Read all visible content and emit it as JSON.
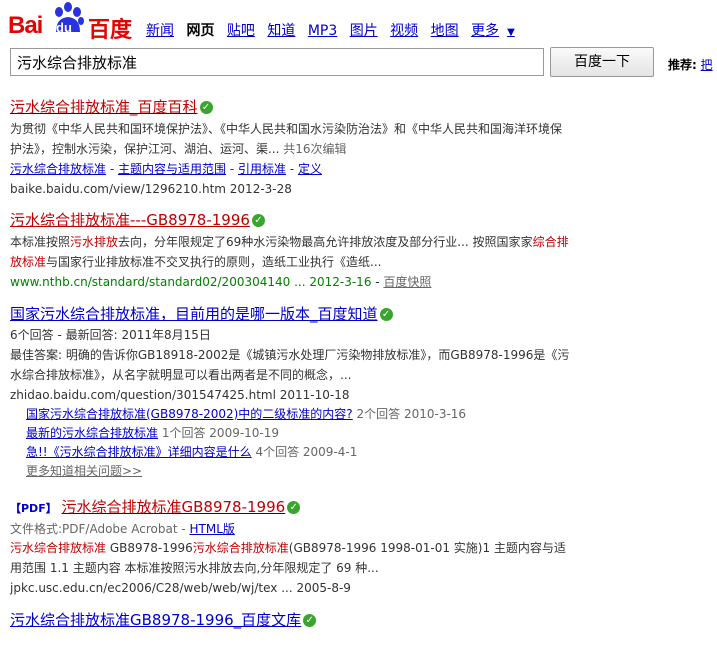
{
  "logo": {
    "bai": "Bai",
    "du": "du",
    "cn": "百度"
  },
  "nav": {
    "items": [
      "新闻",
      "网页",
      "贴吧",
      "知道",
      "MP3",
      "图片",
      "视频",
      "地图",
      "更多"
    ],
    "current": "网页",
    "more_arrow": "▼"
  },
  "search": {
    "value": "污水综合排放标准",
    "button": "百度一下"
  },
  "recommend": {
    "label": "推荐",
    "link": "把"
  },
  "results": [
    {
      "title": "污水综合排放标准_百度百科",
      "abstract": "为贯彻《中华人民共和国环境保护法》、《中华人民共和国水污染防治法》和《中华人民共和国海洋环境保护法》，控制水污染，保护江河、湖泊、运河、渠...",
      "edits": "共16次编辑",
      "sublinks": [
        "污水综合排放标准",
        "主题内容与适用范围",
        "引用标准",
        "定义"
      ],
      "url": "baike.baidu.com/view/1296210.htm 2012-3-28"
    },
    {
      "title": "污水综合排放标准---GB8978-1996",
      "abstract_pre": "本标准按照",
      "abstract_em": "污水排放",
      "abstract_post": "去向，分年限规定了69种水污染物最高允许排放浓度及部分行业... 按照国家",
      "abstract2_em": "综合排放标准",
      "abstract2_post": "与国家行业排放标准不交叉执行的原则，造纸工业执行《造纸...",
      "url": "www.nthb.cn/standard/standard02/200304140 ... 2012-3-16",
      "snapshot": "百度快照"
    },
    {
      "title": "国家污水综合排放标准，目前用的是哪一版本_百度知道",
      "meta": "6个回答 - 最新回答: 2011年8月15日",
      "abstract": "最佳答案: 明确的告诉你GB18918-2002是《城镇污水处理厂污染物排放标准》，而GB8978-1996是《污水综合排放标准》，从名字就明显可以看出两者是不同的概念，...",
      "url": "zhidao.baidu.com/question/301547425.html  2011-10-18",
      "subresults": [
        {
          "title": "国家污水综合排放标准(GB8978-2002)中的二级标准的内容?",
          "meta": "2个回答  2010-3-16"
        },
        {
          "title": "最新的污水综合排放标准",
          "meta": "1个回答  2009-10-19"
        },
        {
          "title": "急!!《污水综合排放标准》详细内容是什么",
          "meta": "4个回答  2009-4-1"
        }
      ],
      "more": "更多知道相关问题>>"
    },
    {
      "tag": "PDF",
      "title": "污水综合排放标准GB8978-1996",
      "format_label": "文件格式:PDF/Adobe Acrobat - ",
      "format_link": "HTML版",
      "abstract_em1": "污水综合排放标准",
      "abstract_mid": "  GB8978-1996",
      "abstract_em2": "污水综合排放标准",
      "abstract_post": "(GB8978-1996 1998-01-01 实施)1 主题内容与适用范围  1.1 主题内容 本标准按照污水排放去向,分年限规定了 69 种...",
      "url": "jpkc.usc.edu.cn/ec2006/C28/web/web/wj/tex ... 2005-8-9"
    },
    {
      "title": "污水综合排放标准GB8978-1996_百度文库"
    }
  ]
}
